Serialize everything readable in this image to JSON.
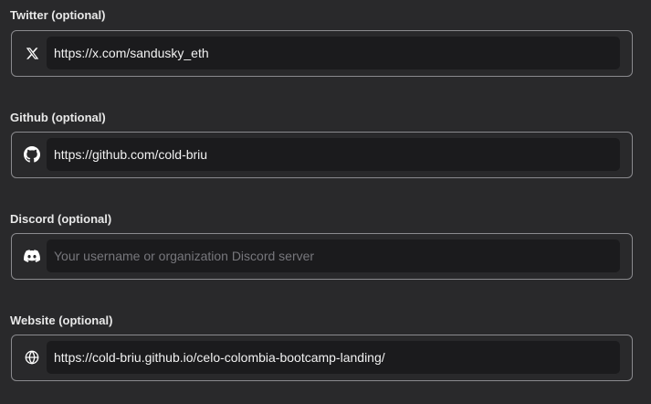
{
  "fields": [
    {
      "label": "Twitter (optional)",
      "icon": "x-logo-icon",
      "value": "https://x.com/sandusky_eth",
      "placeholder": ""
    },
    {
      "label": "Github (optional)",
      "icon": "github-logo-icon",
      "value": "https://github.com/cold-briu",
      "placeholder": ""
    },
    {
      "label": "Discord (optional)",
      "icon": "discord-logo-icon",
      "value": "",
      "placeholder": "Your username or organization Discord server"
    },
    {
      "label": "Website (optional)",
      "icon": "globe-icon",
      "value": "https://cold-briu.github.io/celo-colombia-bootcamp-landing/",
      "placeholder": ""
    }
  ],
  "colors": {
    "background": "#29292b",
    "input_background": "#1b1b1d",
    "border": "#8a8a8e",
    "label_text": "#e8e8e8",
    "placeholder_text": "#77777c"
  }
}
